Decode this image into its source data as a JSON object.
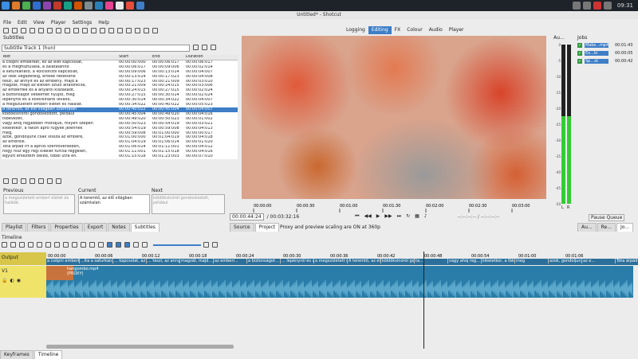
{
  "window": {
    "title": "Untitled* - Shotcut"
  },
  "taskbar": {
    "clock": "09:31"
  },
  "menu": [
    "File",
    "Edit",
    "View",
    "Player",
    "Settings",
    "Help"
  ],
  "layouts": [
    "Logging",
    "Editing",
    "FX",
    "Colour",
    "Audio",
    "Player"
  ],
  "subtitles": {
    "panel_title": "Subtitles",
    "track": "Subtitle Track 1 (hun)",
    "headers": [
      "Text",
      "Start",
      "End",
      "Duration"
    ],
    "rows": [
      [
        "a csöpni emberkét, ez az élet kapcsolat,",
        "00:00:00:000",
        "00:00:06:017",
        "00:00:06:017"
      ],
      [
        "és a megfisztulása, a zalatalanító",
        "00:00:06:017",
        "00:00:09:006",
        "00:00:02:014"
      ],
      [
        "a saturkanató, a kölcsönzői kapcsolat,",
        "00:00:09:006",
        "00:00:13:014",
        "00:00:04:007"
      ],
      [
        "az idők végezetéig, értéke hetetlene",
        "00:00:13:014",
        "00:00:17:023",
        "00:00:04:008"
      ],
      [
        "teszi, az annyit és az embény, majd a",
        "00:00:17:023",
        "00:00:21:009",
        "00:00:03:010"
      ],
      [
        "magzat, majd az eleven szülő általonkilla,",
        "00:00:21:009",
        "00:00:24:015",
        "00:00:03:006"
      ],
      [
        "az emberréé és a anyáról kiszakadt,",
        "00:00:24:015",
        "00:00:27:015",
        "00:00:02:024"
      ],
      [
        "a biztonságot védelmet nyújtó, még",
        "00:00:27:015",
        "00:00:30:014",
        "00:00:02:024"
      ],
      [
        "lepényről és a kölöllsinarói leválló,",
        "00:00:30:014",
        "00:00:34:022",
        "00:00:04:007"
      ],
      [
        "a megszületett emberi életét és halálát.",
        "00:00:34:022",
        "00:00:40:022",
        "00:00:05:023"
      ],
      [
        "A teremtő, az élő világban számtalan",
        "00:00:40:022",
        "00:00:45:004",
        "00:00:04:007"
      ],
      [
        "köldöksinóról gondoskodott, például",
        "00:00:45:004",
        "00:00:49:020",
        "00:00:04:016"
      ],
      [
        "tsbevezet,",
        "00:00:49:020",
        "00:00:50:023",
        "00:00:01:002"
      ],
      [
        "vagy ahoj regjebben mondjuk, milyen szépen",
        "00:00:50:023",
        "00:00:54:019",
        "00:00:03:021"
      ],
      [
        "kikeletkor, a fákon apró rügyek jelennek",
        "00:00:54:019",
        "00:00:59:008",
        "00:00:04:013"
      ],
      [
        "meg,",
        "00:00:59:008",
        "00:01:00:000",
        "00:00:00:017"
      ],
      [
        "azok, gondoljunk csak vissza az embere,",
        "00:01:00:000",
        "00:01:04:019",
        "00:00:04:018"
      ],
      [
        "az embrólk.",
        "00:01:04:019",
        "00:01:06:014",
        "00:00:01:020"
      ],
      [
        "Tóta árpád írt a április szénföversében,",
        "00:01:06:014",
        "00:01:11:001",
        "00:00:04:012"
      ],
      [
        "hogy hisz egy régi kikelet furcsa reggelén,",
        "00:01:11:001",
        "00:01:15:018",
        "00:00:04:016"
      ],
      [
        "együtt érkeztem beled, többi ütra én.",
        "00:01:15:018",
        "00:01:23:003",
        "00:00:07:010"
      ]
    ],
    "selected_row": 10,
    "previous_label": "Previous",
    "current_label": "Current",
    "next_label": "Next",
    "previous_text": "a megszületett emberi életét és halálát.",
    "current_text": "A teremtő, az élő világban számtalan",
    "next_text": "köldöksinóról gondoskodott, például"
  },
  "bottom_tabs": [
    "Playlist",
    "Filters",
    "Properties",
    "Export",
    "Notes",
    "Subtitles"
  ],
  "player": {
    "ruler": [
      "00:00:00",
      "00:00:30",
      "00:01:00",
      "00:01:30",
      "00:02:00",
      "00:02:30",
      "00:03:00"
    ],
    "position": "00:00:44:24",
    "duration": "/ 00:03:32:16",
    "inout": "--:--:--:-- / --:--:--:--",
    "tabs": [
      "Source",
      "Project"
    ],
    "notice": "Proxy and preview scaling are ON at 360p"
  },
  "audio": {
    "title": "Au...",
    "meter_labels": [
      "L",
      "R"
    ],
    "scale": [
      "0",
      "-5",
      "-10",
      "-15",
      "-20",
      "-25",
      "-30",
      "-35",
      "-40",
      "-45",
      "-50"
    ],
    "left_level_pct": 55,
    "right_level_pct": 55
  },
  "jobs": {
    "title": "Jobs",
    "items": [
      [
        "Make...mp4",
        "00:01:43"
      ],
      [
        "Ex...lo",
        "00:00:05"
      ],
      [
        "Sp...xt",
        "00:00:42"
      ]
    ],
    "pause_label": "Pause Queue",
    "tabs": [
      "Au...",
      "Re...",
      "Jo..."
    ]
  },
  "timeline": {
    "title": "Timeline",
    "ruler": [
      "00:00:00",
      "00:00:06",
      "00:00:12",
      "00:00:18",
      "00:00:24",
      "00:00:30",
      "00:00:36",
      "00:00:42",
      "00:00:48",
      "00:00:54",
      "00:01:00",
      "00:01:06"
    ],
    "output_label": "Output",
    "track_name": "V1",
    "clip_name": "hangombo.mp4 (PROXY)",
    "sub_strip": [
      "a csöpni emberkét, ez az ...",
      "...ita a saturkanató...",
      "... kapcsolat, az idők végezet...",
      "... teszi, az annyit és az ember...",
      "magzát, majd...",
      "az emberi...",
      "a biztonságot...",
      "... lepényről és a kölö...",
      "a megszületett emberi...",
      "A teremtő, az élő ...",
      "köldöksinóról gon...",
      "ta...",
      "vagy ahoj reg...",
      "kikeletkor, a fákon...",
      "meg",
      "azok, gondoljunk...",
      "az e...",
      "Tóta árpád írt a"
    ]
  },
  "footer_tabs": [
    "Keyframes",
    "Timeline"
  ]
}
